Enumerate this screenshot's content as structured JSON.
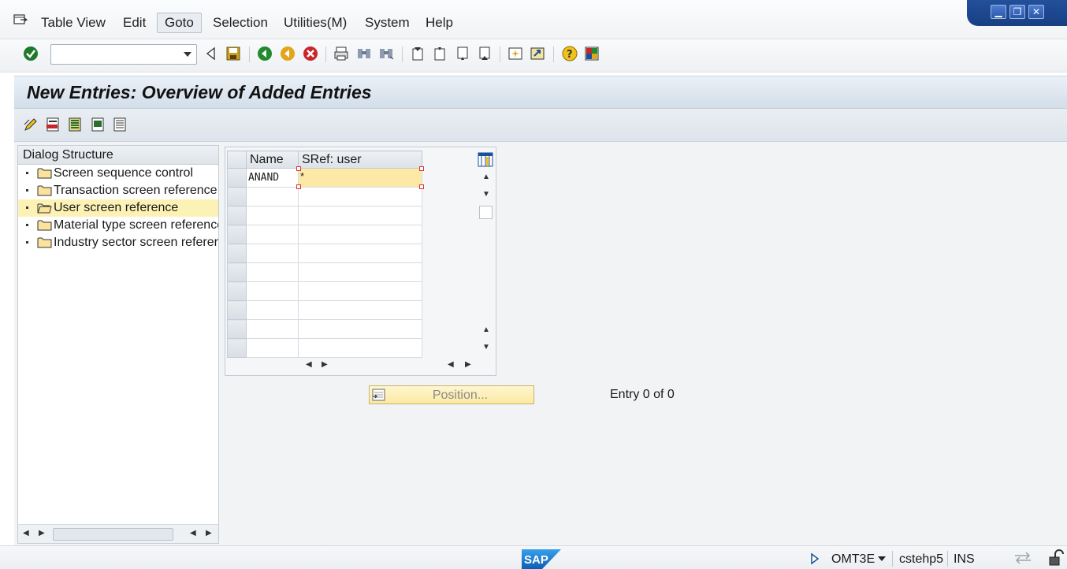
{
  "menubar": {
    "items": [
      "Table View",
      "Edit",
      "Goto",
      "Selection",
      "Utilities(M)",
      "System",
      "Help"
    ],
    "active": "Goto"
  },
  "toolbar": {
    "command_field_value": "",
    "icons": [
      "enter-icon",
      "back-nav-icon",
      "save-icon",
      "back-icon",
      "exit-icon",
      "cancel-icon",
      "print-icon",
      "find-icon",
      "find-next-icon",
      "first-page-icon",
      "previous-page-icon",
      "next-page-icon",
      "last-page-icon",
      "create-session-icon",
      "shortcut-icon",
      "help-icon",
      "layout-menu-icon"
    ]
  },
  "title": "New Entries: Overview of Added Entries",
  "app_toolbar": {
    "icons": [
      "change-display-icon",
      "delete-icon",
      "select-all-icon",
      "select-block-icon",
      "deselect-all-icon"
    ]
  },
  "dialog_structure": {
    "header": "Dialog Structure",
    "items": [
      {
        "label": "Screen sequence control",
        "selected": false
      },
      {
        "label": "Transaction screen reference",
        "selected": false
      },
      {
        "label": "User screen reference",
        "selected": true
      },
      {
        "label": "Material type screen reference",
        "selected": false
      },
      {
        "label": "Industry sector screen referer",
        "selected": false
      }
    ]
  },
  "table": {
    "columns": [
      "Name",
      "SRef: user"
    ],
    "rows": [
      {
        "name": "ANAND",
        "sref": "*"
      },
      {
        "name": "",
        "sref": ""
      },
      {
        "name": "",
        "sref": ""
      },
      {
        "name": "",
        "sref": ""
      },
      {
        "name": "",
        "sref": ""
      },
      {
        "name": "",
        "sref": ""
      },
      {
        "name": "",
        "sref": ""
      },
      {
        "name": "",
        "sref": ""
      },
      {
        "name": "",
        "sref": ""
      },
      {
        "name": "",
        "sref": ""
      }
    ]
  },
  "position_button": "Position...",
  "entry_info": "Entry 0 of 0",
  "statusbar": {
    "system": "OMT3E",
    "server": "cstehp5",
    "mode": "INS",
    "logo": "SAP"
  }
}
